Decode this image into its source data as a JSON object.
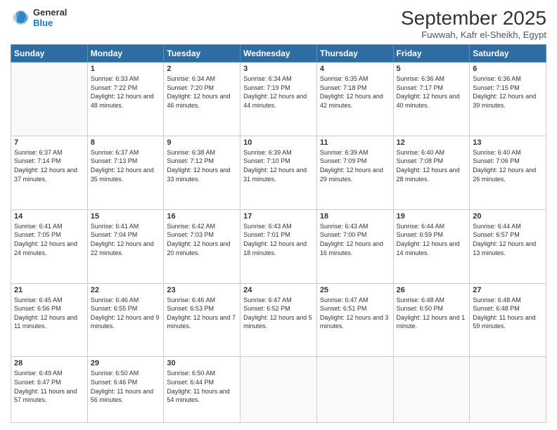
{
  "header": {
    "logo_general": "General",
    "logo_blue": "Blue",
    "month_year": "September 2025",
    "location": "Fuwwah, Kafr el-Sheikh, Egypt"
  },
  "days_of_week": [
    "Sunday",
    "Monday",
    "Tuesday",
    "Wednesday",
    "Thursday",
    "Friday",
    "Saturday"
  ],
  "weeks": [
    [
      {
        "day": "",
        "sunrise": "",
        "sunset": "",
        "daylight": ""
      },
      {
        "day": "1",
        "sunrise": "Sunrise: 6:33 AM",
        "sunset": "Sunset: 7:22 PM",
        "daylight": "Daylight: 12 hours and 48 minutes."
      },
      {
        "day": "2",
        "sunrise": "Sunrise: 6:34 AM",
        "sunset": "Sunset: 7:20 PM",
        "daylight": "Daylight: 12 hours and 46 minutes."
      },
      {
        "day": "3",
        "sunrise": "Sunrise: 6:34 AM",
        "sunset": "Sunset: 7:19 PM",
        "daylight": "Daylight: 12 hours and 44 minutes."
      },
      {
        "day": "4",
        "sunrise": "Sunrise: 6:35 AM",
        "sunset": "Sunset: 7:18 PM",
        "daylight": "Daylight: 12 hours and 42 minutes."
      },
      {
        "day": "5",
        "sunrise": "Sunrise: 6:36 AM",
        "sunset": "Sunset: 7:17 PM",
        "daylight": "Daylight: 12 hours and 40 minutes."
      },
      {
        "day": "6",
        "sunrise": "Sunrise: 6:36 AM",
        "sunset": "Sunset: 7:15 PM",
        "daylight": "Daylight: 12 hours and 39 minutes."
      }
    ],
    [
      {
        "day": "7",
        "sunrise": "Sunrise: 6:37 AM",
        "sunset": "Sunset: 7:14 PM",
        "daylight": "Daylight: 12 hours and 37 minutes."
      },
      {
        "day": "8",
        "sunrise": "Sunrise: 6:37 AM",
        "sunset": "Sunset: 7:13 PM",
        "daylight": "Daylight: 12 hours and 35 minutes."
      },
      {
        "day": "9",
        "sunrise": "Sunrise: 6:38 AM",
        "sunset": "Sunset: 7:12 PM",
        "daylight": "Daylight: 12 hours and 33 minutes."
      },
      {
        "day": "10",
        "sunrise": "Sunrise: 6:39 AM",
        "sunset": "Sunset: 7:10 PM",
        "daylight": "Daylight: 12 hours and 31 minutes."
      },
      {
        "day": "11",
        "sunrise": "Sunrise: 6:39 AM",
        "sunset": "Sunset: 7:09 PM",
        "daylight": "Daylight: 12 hours and 29 minutes."
      },
      {
        "day": "12",
        "sunrise": "Sunrise: 6:40 AM",
        "sunset": "Sunset: 7:08 PM",
        "daylight": "Daylight: 12 hours and 28 minutes."
      },
      {
        "day": "13",
        "sunrise": "Sunrise: 6:40 AM",
        "sunset": "Sunset: 7:06 PM",
        "daylight": "Daylight: 12 hours and 26 minutes."
      }
    ],
    [
      {
        "day": "14",
        "sunrise": "Sunrise: 6:41 AM",
        "sunset": "Sunset: 7:05 PM",
        "daylight": "Daylight: 12 hours and 24 minutes."
      },
      {
        "day": "15",
        "sunrise": "Sunrise: 6:41 AM",
        "sunset": "Sunset: 7:04 PM",
        "daylight": "Daylight: 12 hours and 22 minutes."
      },
      {
        "day": "16",
        "sunrise": "Sunrise: 6:42 AM",
        "sunset": "Sunset: 7:03 PM",
        "daylight": "Daylight: 12 hours and 20 minutes."
      },
      {
        "day": "17",
        "sunrise": "Sunrise: 6:43 AM",
        "sunset": "Sunset: 7:01 PM",
        "daylight": "Daylight: 12 hours and 18 minutes."
      },
      {
        "day": "18",
        "sunrise": "Sunrise: 6:43 AM",
        "sunset": "Sunset: 7:00 PM",
        "daylight": "Daylight: 12 hours and 16 minutes."
      },
      {
        "day": "19",
        "sunrise": "Sunrise: 6:44 AM",
        "sunset": "Sunset: 6:59 PM",
        "daylight": "Daylight: 12 hours and 14 minutes."
      },
      {
        "day": "20",
        "sunrise": "Sunrise: 6:44 AM",
        "sunset": "Sunset: 6:57 PM",
        "daylight": "Daylight: 12 hours and 13 minutes."
      }
    ],
    [
      {
        "day": "21",
        "sunrise": "Sunrise: 6:45 AM",
        "sunset": "Sunset: 6:56 PM",
        "daylight": "Daylight: 12 hours and 11 minutes."
      },
      {
        "day": "22",
        "sunrise": "Sunrise: 6:46 AM",
        "sunset": "Sunset: 6:55 PM",
        "daylight": "Daylight: 12 hours and 9 minutes."
      },
      {
        "day": "23",
        "sunrise": "Sunrise: 6:46 AM",
        "sunset": "Sunset: 6:53 PM",
        "daylight": "Daylight: 12 hours and 7 minutes."
      },
      {
        "day": "24",
        "sunrise": "Sunrise: 6:47 AM",
        "sunset": "Sunset: 6:52 PM",
        "daylight": "Daylight: 12 hours and 5 minutes."
      },
      {
        "day": "25",
        "sunrise": "Sunrise: 6:47 AM",
        "sunset": "Sunset: 6:51 PM",
        "daylight": "Daylight: 12 hours and 3 minutes."
      },
      {
        "day": "26",
        "sunrise": "Sunrise: 6:48 AM",
        "sunset": "Sunset: 6:50 PM",
        "daylight": "Daylight: 12 hours and 1 minute."
      },
      {
        "day": "27",
        "sunrise": "Sunrise: 6:48 AM",
        "sunset": "Sunset: 6:48 PM",
        "daylight": "Daylight: 11 hours and 59 minutes."
      }
    ],
    [
      {
        "day": "28",
        "sunrise": "Sunrise: 6:49 AM",
        "sunset": "Sunset: 6:47 PM",
        "daylight": "Daylight: 11 hours and 57 minutes."
      },
      {
        "day": "29",
        "sunrise": "Sunrise: 6:50 AM",
        "sunset": "Sunset: 6:46 PM",
        "daylight": "Daylight: 11 hours and 56 minutes."
      },
      {
        "day": "30",
        "sunrise": "Sunrise: 6:50 AM",
        "sunset": "Sunset: 6:44 PM",
        "daylight": "Daylight: 11 hours and 54 minutes."
      },
      {
        "day": "",
        "sunrise": "",
        "sunset": "",
        "daylight": ""
      },
      {
        "day": "",
        "sunrise": "",
        "sunset": "",
        "daylight": ""
      },
      {
        "day": "",
        "sunrise": "",
        "sunset": "",
        "daylight": ""
      },
      {
        "day": "",
        "sunrise": "",
        "sunset": "",
        "daylight": ""
      }
    ]
  ]
}
